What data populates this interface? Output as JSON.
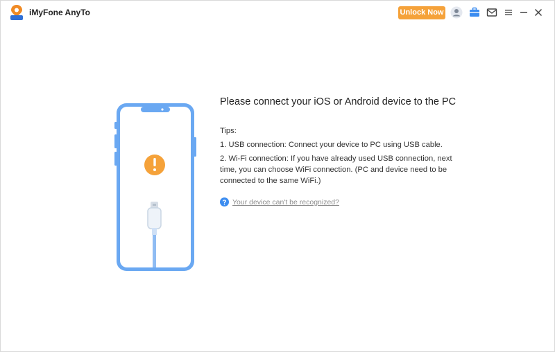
{
  "app": {
    "title": "iMyFone AnyTo",
    "unlock_label": "Unlock Now",
    "icons": [
      "account-icon",
      "toolbox-icon",
      "mail-icon",
      "menu-icon",
      "minimize-icon",
      "close-icon"
    ]
  },
  "main": {
    "heading": "Please connect your iOS or Android device to the PC",
    "tips_title": "Tips:",
    "tips": [
      "1. USB connection: Connect your device to PC using USB cable.",
      "2. Wi-Fi connection: If you have already used USB connection, next time, you can choose WiFi connection. (PC and device need to be connected to the same WiFi.)"
    ],
    "help_link": "Your device can't be recognized?"
  },
  "colors": {
    "accent_orange": "#f5a23a",
    "phone_blue": "#6aa8f2",
    "link_blue": "#3b8cf0"
  }
}
